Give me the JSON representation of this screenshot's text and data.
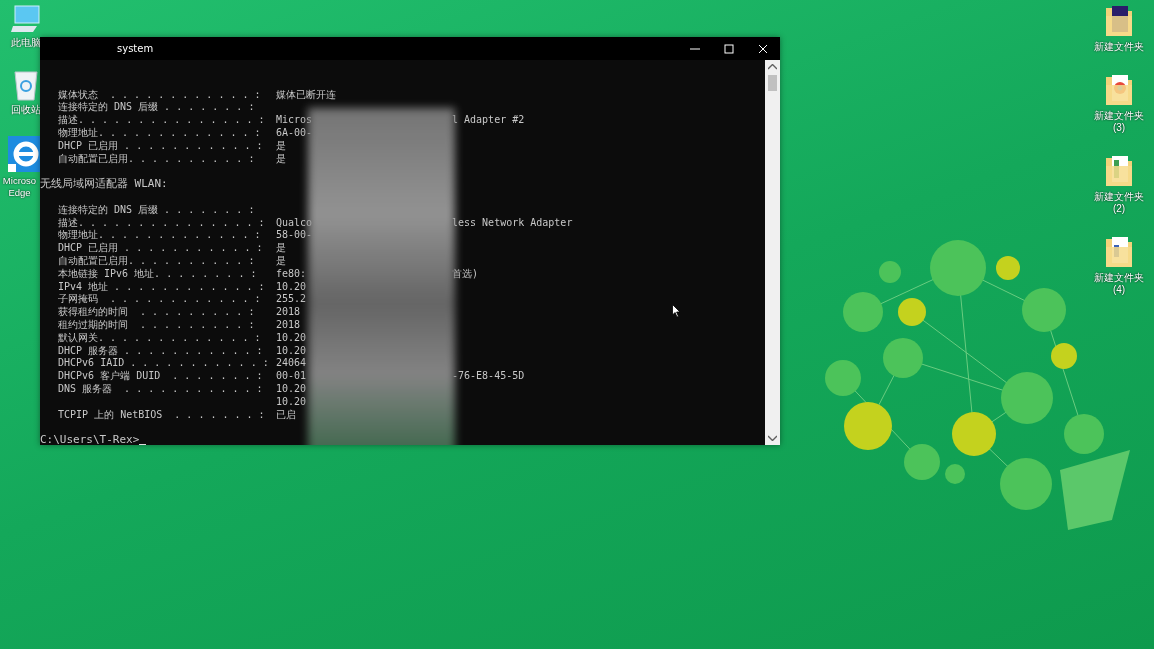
{
  "desktop_left": [
    {
      "kind": "computer",
      "label": "此电脑"
    },
    {
      "kind": "recycle",
      "label": "回收站"
    },
    {
      "kind": "edge",
      "label": "Microso Edge"
    }
  ],
  "desktop_right": [
    {
      "kind": "folder-ps",
      "label": "新建文件夹"
    },
    {
      "kind": "folder-chrome",
      "label": "新建文件夹 (3)"
    },
    {
      "kind": "folder-sheet",
      "label": "新建文件夹 (2)"
    },
    {
      "kind": "folder-doc",
      "label": "新建文件夹 (4)"
    }
  ],
  "window": {
    "title": "system"
  },
  "console": {
    "lines": [
      {
        "kind": "blank"
      },
      {
        "kind": "blank"
      },
      {
        "kind": "entry",
        "label": "媒体状态  . . . . . . . . . . . . :",
        "value": "媒体已断开连"
      },
      {
        "kind": "entry",
        "label": "连接特定的 DNS 后缀 . . . . . . . :"
      },
      {
        "kind": "entry",
        "label": "描述. . . . . . . . . . . . . . . :",
        "value": "Micros",
        "value_end": "l Adapter #2"
      },
      {
        "kind": "entry",
        "label": "物理地址. . . . . . . . . . . . . :",
        "value": "6A-00-"
      },
      {
        "kind": "entry",
        "label": "DHCP 已启用 . . . . . . . . . . . :",
        "value": "是"
      },
      {
        "kind": "entry",
        "label": "自动配置已启用. . . . . . . . . . :",
        "value": "是"
      },
      {
        "kind": "blank"
      },
      {
        "kind": "header",
        "text": "无线局域网适配器 WLAN:"
      },
      {
        "kind": "blank"
      },
      {
        "kind": "entry",
        "label": "连接特定的 DNS 后缀 . . . . . . . :"
      },
      {
        "kind": "entry",
        "label": "描述. . . . . . . . . . . . . . . :",
        "value": "Qualco",
        "value_end": "less Network Adapter"
      },
      {
        "kind": "entry",
        "label": "物理地址. . . . . . . . . . . . . :",
        "value": "58-00-"
      },
      {
        "kind": "entry",
        "label": "DHCP 已启用 . . . . . . . . . . . :",
        "value": "是"
      },
      {
        "kind": "entry",
        "label": "自动配置已启用. . . . . . . . . . :",
        "value": "是"
      },
      {
        "kind": "entry",
        "label": "本地链接 IPv6 地址. . . . . . . . :",
        "value": "fe80:",
        "value_end": "首选)"
      },
      {
        "kind": "entry",
        "label": "IPv4 地址 . . . . . . . . . . . . :",
        "value": "10.20"
      },
      {
        "kind": "entry",
        "label": "子网掩码  . . . . . . . . . . . . :",
        "value": "255.2"
      },
      {
        "kind": "entry",
        "label": "获得租约的时间  . . . . . . . . . :",
        "value": "2018"
      },
      {
        "kind": "entry",
        "label": "租约过期的时间  . . . . . . . . . :",
        "value": "2018"
      },
      {
        "kind": "entry",
        "label": "默认网关. . . . . . . . . . . . . :",
        "value": "10.20"
      },
      {
        "kind": "entry",
        "label": "DHCP 服务器 . . . . . . . . . . . :",
        "value": "10.20"
      },
      {
        "kind": "entry",
        "label": "DHCPv6 IAID . . . . . . . . . . . :",
        "value": "24064"
      },
      {
        "kind": "entry",
        "label": "DHCPv6 客户端 DUID  . . . . . . . :",
        "value": "00-01",
        "value_end": "-76-E8-45-5D"
      },
      {
        "kind": "entry",
        "label": "DNS 服务器  . . . . . . . . . . . :",
        "value": "10.20"
      },
      {
        "kind": "continuation",
        "value": "10.20"
      },
      {
        "kind": "entry",
        "label": "TCPIP 上的 NetBIOS  . . . . . . . :",
        "value": "已启"
      },
      {
        "kind": "blank"
      },
      {
        "kind": "prompt",
        "text": "C:\\Users\\T-Rex>"
      }
    ]
  }
}
